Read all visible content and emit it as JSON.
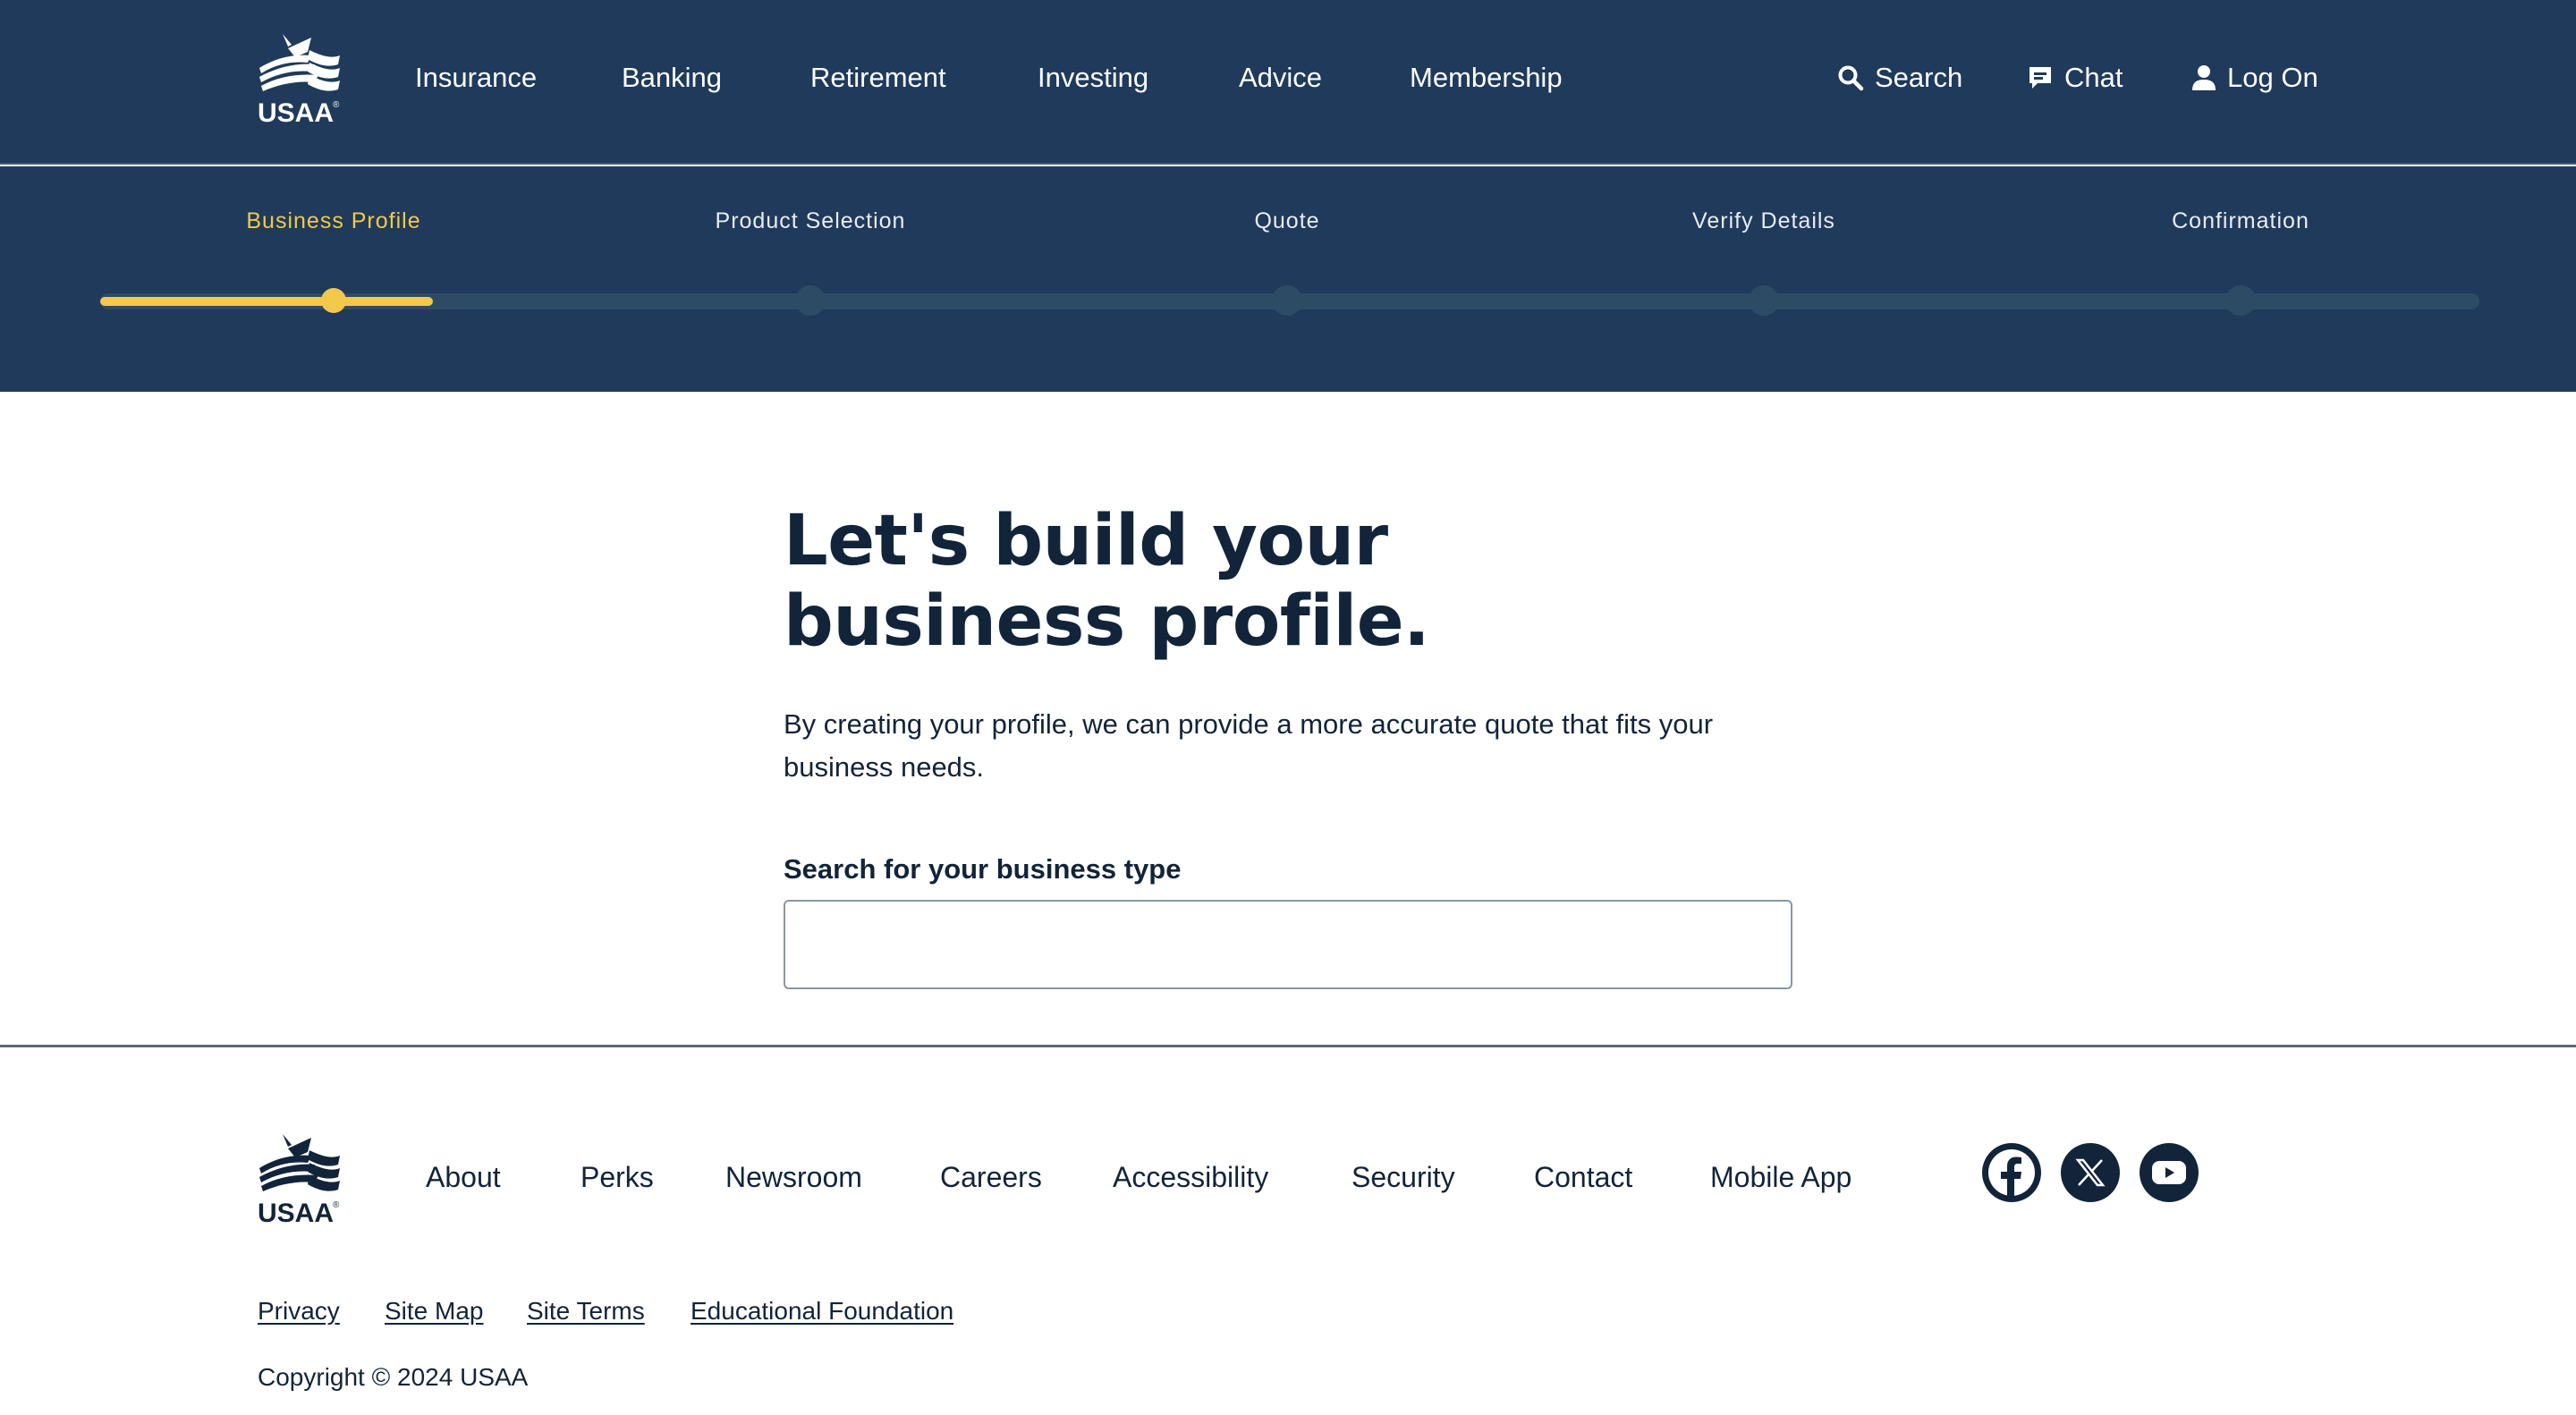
{
  "brand": {
    "name": "USAA",
    "primary_color": "#1f3a5a",
    "accent_color": "#f2c94c",
    "text_color": "#12243a"
  },
  "header": {
    "nav": [
      "Insurance",
      "Banking",
      "Retirement",
      "Investing",
      "Advice",
      "Membership"
    ],
    "utility": {
      "search": {
        "label": "Search",
        "icon": "search-icon"
      },
      "chat": {
        "label": "Chat",
        "icon": "chat-icon"
      },
      "login": {
        "label": "Log On",
        "icon": "user-icon"
      }
    }
  },
  "stepper": {
    "steps": [
      "Business Profile",
      "Product Selection",
      "Quote",
      "Verify Details",
      "Confirmation"
    ],
    "current_step": 1,
    "progress_fraction": 0.14
  },
  "main": {
    "title": "Let's build your business profile.",
    "intro": "By creating your profile, we can provide a more accurate quote that fits your business needs.",
    "search_label": "Search for your business type",
    "search_value": ""
  },
  "footer": {
    "links": [
      "About",
      "Perks",
      "Newsroom",
      "Careers",
      "Accessibility",
      "Security",
      "Contact",
      "Mobile App"
    ],
    "social": [
      "facebook-icon",
      "x-icon",
      "youtube-icon"
    ],
    "legal": [
      "Privacy",
      "Site Map",
      "Site Terms",
      "Educational Foundation"
    ],
    "copyright": "Copyright © 2024 USAA"
  }
}
